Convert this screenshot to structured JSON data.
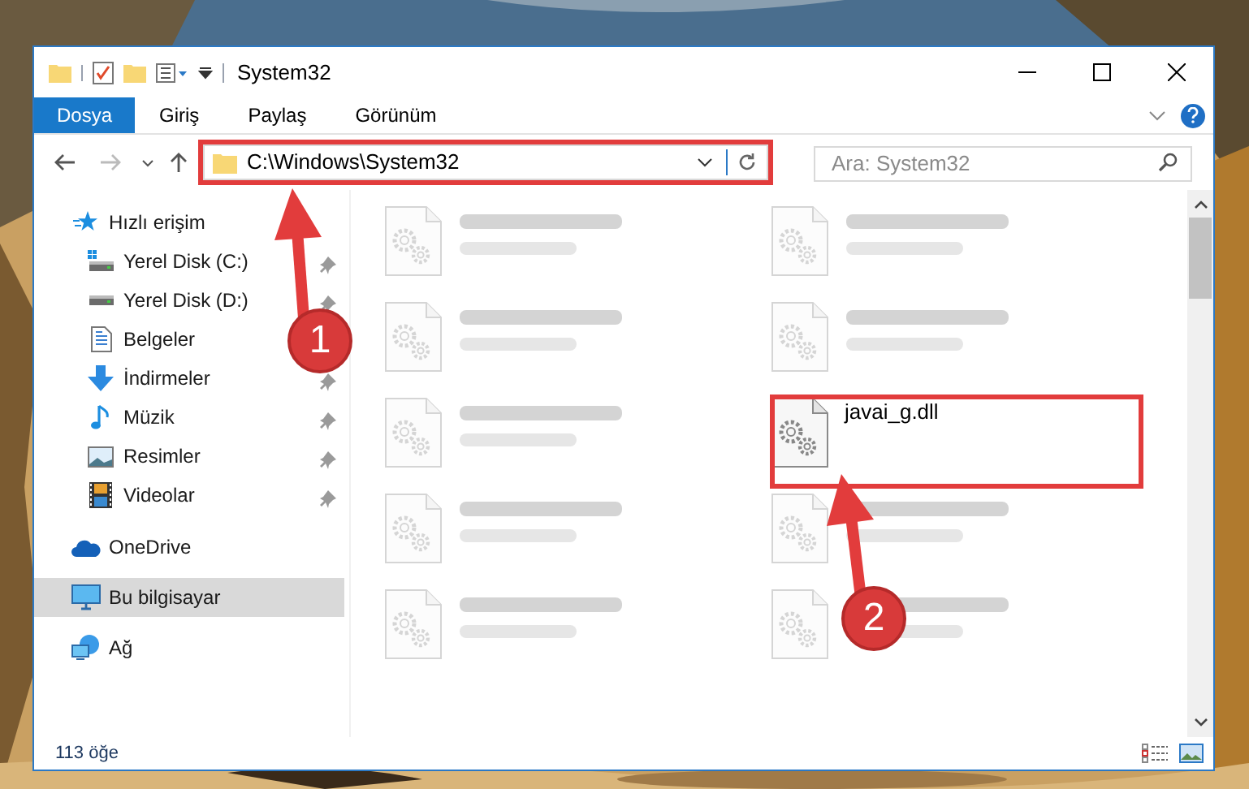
{
  "window": {
    "title": "System32"
  },
  "ribbon_tabs": [
    {
      "label": "Dosya",
      "selected": true
    },
    {
      "label": "Giriş",
      "selected": false
    },
    {
      "label": "Paylaş",
      "selected": false
    },
    {
      "label": "Görünüm",
      "selected": false
    }
  ],
  "address_bar": {
    "path": "C:\\Windows\\System32"
  },
  "search": {
    "placeholder": "Ara: System32"
  },
  "sidebar": {
    "items": [
      {
        "label": "Hızlı erişim",
        "kind": "quick",
        "selected": false,
        "children": [
          {
            "label": "Yerel Disk (C:)",
            "kind": "system-drive",
            "pinned": true
          },
          {
            "label": "Yerel Disk (D:)",
            "kind": "drive",
            "pinned": true
          },
          {
            "label": "Belgeler",
            "kind": "documents",
            "pinned": false
          },
          {
            "label": "İndirmeler",
            "kind": "downloads",
            "pinned": true
          },
          {
            "label": "Müzik",
            "kind": "music",
            "pinned": true
          },
          {
            "label": "Resimler",
            "kind": "pictures",
            "pinned": true
          },
          {
            "label": "Videolar",
            "kind": "videos",
            "pinned": true
          }
        ]
      },
      {
        "label": "OneDrive",
        "kind": "cloud",
        "selected": false
      },
      {
        "label": "Bu bilgisayar",
        "kind": "computer",
        "selected": true
      },
      {
        "label": "Ağ",
        "kind": "network",
        "selected": false
      }
    ]
  },
  "files": [
    {
      "blurred": true
    },
    {
      "blurred": true
    },
    {
      "blurred": true
    },
    {
      "blurred": true
    },
    {
      "blurred": true
    },
    {
      "name": "javai_g.dll",
      "blurred": false
    },
    {
      "blurred": true
    },
    {
      "blurred": true
    },
    {
      "blurred": true
    },
    {
      "blurred": true
    }
  ],
  "status_bar": {
    "count": "113 öğe"
  },
  "annotations": [
    {
      "label": "1"
    },
    {
      "label": "2"
    }
  ]
}
